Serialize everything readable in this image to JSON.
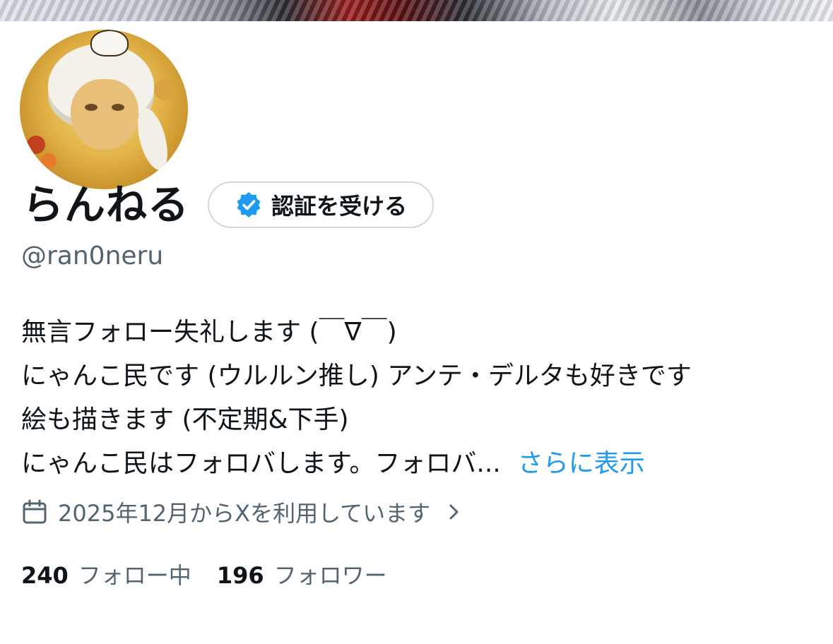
{
  "profile": {
    "display_name": "らんねる",
    "handle": "@ran0neru",
    "verify_button_label": "認証を受ける",
    "bio_lines": [
      "無言フォロー失礼します (￣∇￣)",
      "にゃんこ民です (ウルルン推し) アンテ・デルタも好きです",
      "絵も描きます (不定期&下手)",
      "にゃんこ民はフォロバします。フォロバ..."
    ],
    "show_more_label": "さらに表示",
    "joined_text": "2025年12月からXを利用しています",
    "following_count": "240",
    "following_label": "フォロー中",
    "followers_count": "196",
    "followers_label": "フォロワー"
  },
  "icons": {
    "verified": "verified-badge-icon",
    "calendar": "calendar-icon",
    "chevron": "chevron-right-icon"
  },
  "colors": {
    "accent": "#1d9bf0",
    "text_primary": "#0f1419",
    "text_secondary": "#536471",
    "border": "#cfd9de"
  }
}
